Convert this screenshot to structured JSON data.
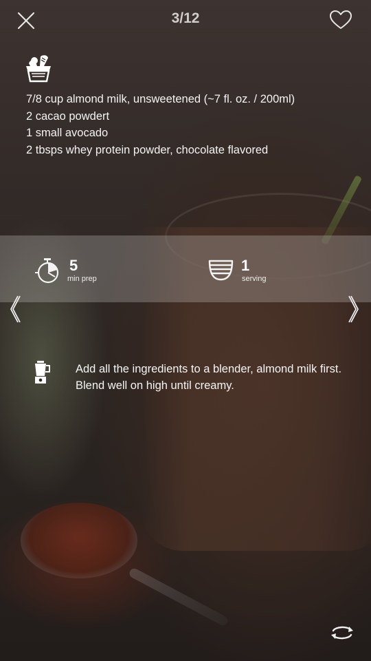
{
  "header": {
    "page_indicator": "3/12",
    "close_icon": "close-icon",
    "favorite_icon": "heart-icon"
  },
  "ingredients": {
    "icon": "grocery-bag-icon",
    "items": [
      "7/8 cup almond milk, unsweetened (~7 fl. oz. / 200ml)",
      "2 cacao powdert",
      "1 small avocado",
      "2 tbsps whey protein powder, chocolate flavored"
    ]
  },
  "info": {
    "prep": {
      "icon": "timer-icon",
      "value": "5",
      "unit": "min prep"
    },
    "serving": {
      "icon": "bowls-icon",
      "value": "1",
      "unit": "serving"
    }
  },
  "navigation": {
    "prev_icon": "chevron-left-icon",
    "next_icon": "chevron-right-icon"
  },
  "instructions": {
    "icon": "blender-icon",
    "text": "Add all the ingredients to a blender, almond milk first. Blend well on high until creamy."
  },
  "footer": {
    "rotate_icon": "rotate-icon"
  },
  "colors": {
    "text": "#f3f3f3",
    "band": "#bebab6",
    "background": "#2b2522"
  }
}
